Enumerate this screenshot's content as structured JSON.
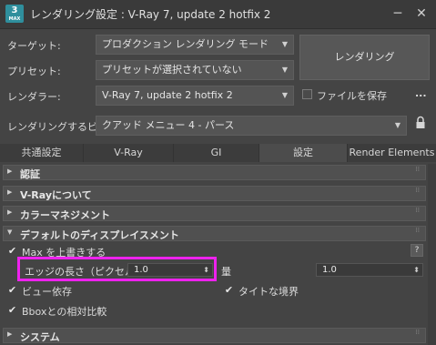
{
  "window": {
    "app_icon_text": "3",
    "app_icon_sub": "MAX",
    "title": "レンダリング設定 : V-Ray 7, update 2 hotfix 2",
    "minimize_glyph": "─",
    "close_glyph": "✕"
  },
  "settings": {
    "target_label": "ターゲット:",
    "target_value": "プロダクション レンダリング モード",
    "preset_label": "プリセット:",
    "preset_value": "プリセットが選択されていない",
    "renderer_label": "レンダラー:",
    "renderer_value": "V-Ray 7, update 2 hotfix 2",
    "save_file_label": "ファイルを保存",
    "more_label": "...",
    "view_label": "レンダリングするビュー:",
    "view_value": "クアッド メニュー 4 - パース",
    "render_button": "レンダリング"
  },
  "tabs": [
    {
      "label": "共通設定"
    },
    {
      "label": "V-Ray"
    },
    {
      "label": "GI"
    },
    {
      "label": "設定",
      "active": true
    },
    {
      "label": "Render Elements"
    }
  ],
  "rollouts": {
    "auth": "認証",
    "about": "V-Rayについて",
    "color_mgmt": "カラーマネジメント",
    "displacement": "デフォルトのディスプレイスメント",
    "system": "システム"
  },
  "displacement": {
    "override_max_label": "Max を上書きする",
    "override_max_checked": true,
    "edge_length_label": "エッジの長さ（ピクセル）",
    "edge_length_value": "1.0",
    "amount_label": "量",
    "amount_value": "1.0",
    "view_dependent_label": "ビュー依存",
    "view_dependent_checked": true,
    "tight_bounds_label": "タイトな境界",
    "tight_bounds_checked": true,
    "bbox_relative_label": "Bboxとの相対比較",
    "bbox_relative_checked": true,
    "help_label": "?"
  },
  "colors": {
    "highlight": "#ee22ee",
    "background": "#444444"
  }
}
